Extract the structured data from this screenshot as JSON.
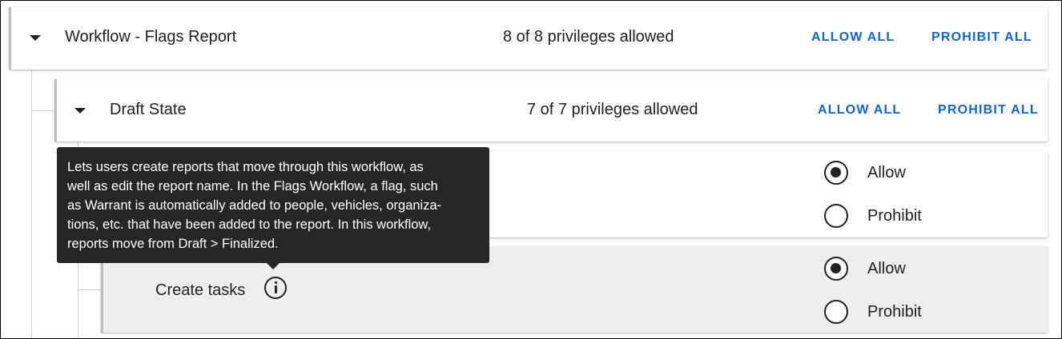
{
  "workflow": {
    "title": "Workflow - Flags Report",
    "count": "8 of 8 privileges allowed",
    "allow_all": "ALLOW ALL",
    "prohibit_all": "PROHIBIT ALL"
  },
  "state": {
    "title": "Draft State",
    "count": "7 of 7 privileges allowed",
    "allow_all": "ALLOW ALL",
    "prohibit_all": "PROHIBIT ALL"
  },
  "privileges": [
    {
      "label": "",
      "allow": "Allow",
      "prohibit": "Prohibit",
      "selected": "allow"
    },
    {
      "label": "Create tasks",
      "allow": "Allow",
      "prohibit": "Prohibit",
      "selected": "allow"
    }
  ],
  "tooltip": {
    "lines": [
      "Lets users create reports that move through this workflow, as",
      "well as edit the report name. In the Flags Workflow, a flag, such",
      "as Warrant is automatically added to people, vehicles, organiza-",
      "tions, etc. that have been added to the report. In this workflow,",
      "reports move from Draft > Finalized."
    ]
  },
  "icons": {
    "expand": "caret-down-icon",
    "info": "info-icon"
  }
}
